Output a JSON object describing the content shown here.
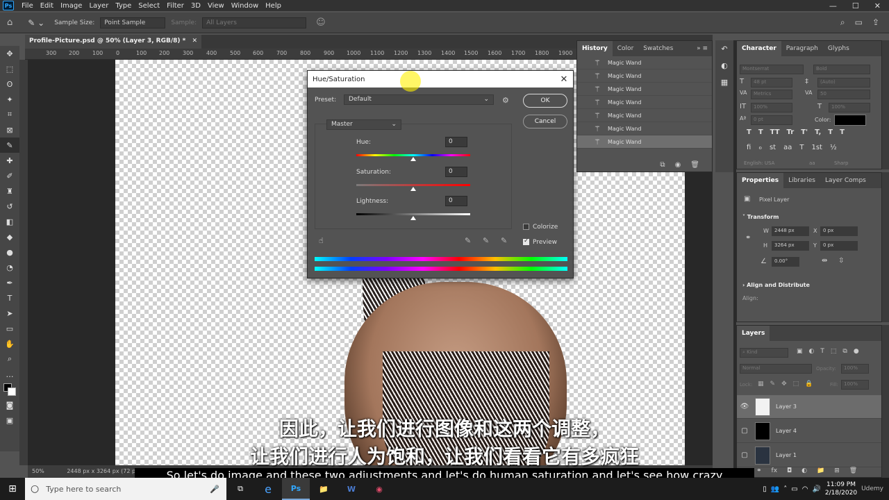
{
  "menubar": {
    "logo": "Ps",
    "items": [
      "File",
      "Edit",
      "Image",
      "Layer",
      "Type",
      "Select",
      "Filter",
      "3D",
      "View",
      "Window",
      "Help"
    ]
  },
  "options": {
    "sample_size_label": "Sample Size:",
    "sample_size_value": "Point Sample",
    "sample_label": "Sample:",
    "sample_value": "All Layers"
  },
  "document": {
    "tab_title": "Profile-Picture.psd @ 50% (Layer 3, RGB/8) *",
    "ruler_ticks": [
      "300",
      "200",
      "100",
      "0",
      "100",
      "200",
      "300",
      "400",
      "500",
      "600",
      "700",
      "800",
      "900",
      "1000",
      "1100",
      "1200",
      "1300",
      "1400",
      "1500",
      "1600",
      "1700",
      "1800",
      "1900"
    ],
    "zoom": "50%",
    "doc_info": "2448 px x 3264 px (72 ppi)"
  },
  "hue_saturation": {
    "title": "Hue/Saturation",
    "preset_label": "Preset:",
    "preset_value": "Default",
    "ok_label": "OK",
    "cancel_label": "Cancel",
    "channel": "Master",
    "hue_label": "Hue:",
    "hue_value": "0",
    "saturation_label": "Saturation:",
    "saturation_value": "0",
    "lightness_label": "Lightness:",
    "lightness_value": "0",
    "colorize_label": "Colorize",
    "preview_label": "Preview",
    "colorize_checked": false,
    "preview_checked": true
  },
  "history": {
    "tabs": [
      "History",
      "Color",
      "Swatches"
    ],
    "items": [
      "Magic Wand",
      "Magic Wand",
      "Magic Wand",
      "Magic Wand",
      "Magic Wand",
      "Magic Wand",
      "Magic Wand"
    ]
  },
  "character": {
    "tabs": [
      "Character",
      "Paragraph",
      "Glyphs"
    ],
    "font_family": "Montserrat",
    "font_style": "Bold",
    "font_size": "48 pt",
    "leading": "(Auto)",
    "kerning": "Metrics",
    "tracking": "50",
    "vscale": "100%",
    "hscale": "100%",
    "baseline": "0 pt",
    "color_label": "Color:",
    "style_buttons": [
      "T",
      "T",
      "TT",
      "Tr",
      "T'",
      "T,",
      "T",
      "T"
    ],
    "ot_buttons": [
      "fi",
      "ℴ",
      "st",
      "aa",
      "T",
      "1st",
      "½"
    ],
    "language": "English: USA",
    "aa_label": "aa",
    "antialias": "Sharp"
  },
  "properties": {
    "tabs": [
      "Properties",
      "Libraries",
      "Layer Comps"
    ],
    "kind": "Pixel Layer",
    "transform_title": "Transform",
    "w_label": "W",
    "w_value": "2448 px",
    "h_label": "H",
    "h_value": "3264 px",
    "x_label": "X",
    "x_value": "0 px",
    "y_label": "Y",
    "y_value": "0 px",
    "angle": "0.00°",
    "align_title": "Align and Distribute",
    "align_label": "Align:"
  },
  "layers": {
    "tab": "Layers",
    "filter_kind": "Kind",
    "blend_mode": "Normal",
    "opacity_label": "Opacity:",
    "opacity_value": "100%",
    "lock_label": "Lock:",
    "fill_label": "Fill:",
    "fill_value": "100%",
    "items": [
      {
        "name": "Layer 3",
        "selected": true,
        "visible": true
      },
      {
        "name": "Layer 4",
        "selected": false,
        "visible": false
      },
      {
        "name": "Layer 1",
        "selected": false,
        "visible": false
      }
    ]
  },
  "subtitles": {
    "cn_line1": "因此，让我们进行图像和这两个调整，",
    "cn_line2": "让我们进行人为饱和，让我们看看它有多疯狂",
    "en_line": "So let's do image and these two adjustments and let's do human saturation and let's see how crazy"
  },
  "taskbar": {
    "search_placeholder": "Type here to search",
    "apps": [
      "e",
      "Ps",
      "📁",
      "W",
      "◉"
    ],
    "time": "11:09 PM",
    "date": "2/18/2020",
    "watermark": "Udemy"
  },
  "colors": {
    "ui_bg": "#535353",
    "menubar": "#323232",
    "dialog_title": "#ffffff",
    "selection": "#6c6c6c"
  }
}
